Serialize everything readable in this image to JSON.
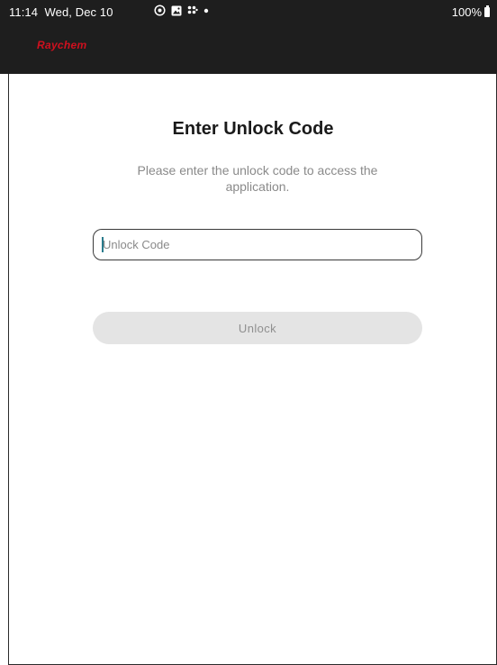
{
  "status_bar": {
    "time": "11:14",
    "date": "Wed, Dec 10",
    "icons": [
      "location-icon",
      "gallery-icon",
      "apps-grid-icon",
      "notification-dot-icon"
    ],
    "battery_level": "100%"
  },
  "app_bar": {
    "logo_text": "Raychem",
    "brand_color": "#d0101e",
    "background_color": "#1e1e1e"
  },
  "unlock_form": {
    "title": "Enter Unlock Code",
    "subtitle": "Please enter the unlock code to access the application.",
    "code_field": {
      "placeholder": "Unlock Code",
      "value": ""
    },
    "submit_label": "Unlock",
    "submit_enabled": false
  },
  "colors": {
    "accent_caret": "#2a7b8c",
    "disabled_button_bg": "#e4e4e4",
    "disabled_button_text": "#8f8f8f"
  }
}
